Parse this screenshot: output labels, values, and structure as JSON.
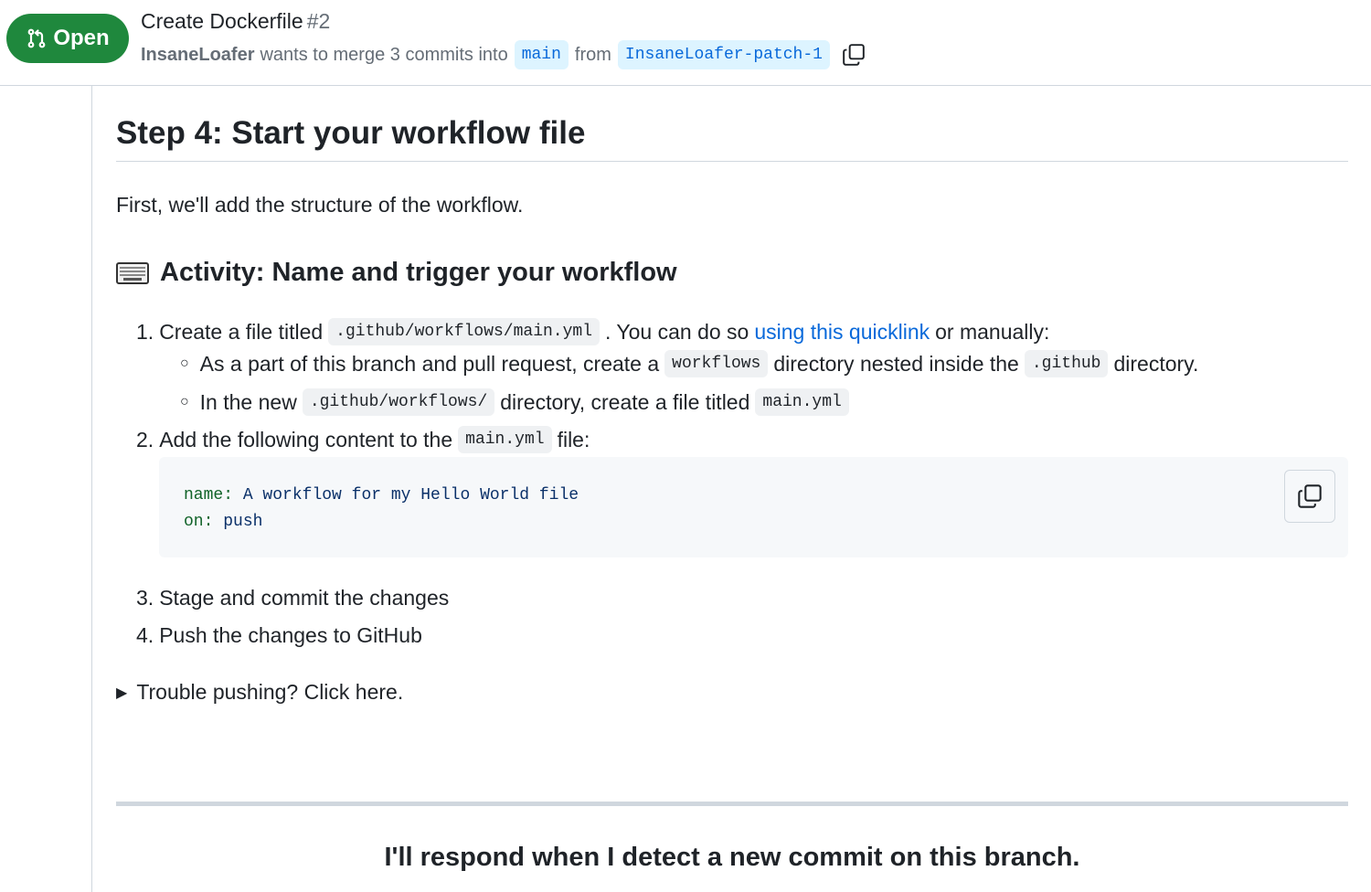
{
  "header": {
    "state_label": "Open",
    "title": "Create Dockerfile",
    "number": "#2",
    "author": "InsaneLoafer",
    "merge_text": "wants to merge 3 commits into",
    "base_branch": "main",
    "from_text": "from",
    "head_branch": "InsaneLoafer-patch-1",
    "copy_icon": "copy-icon",
    "state_color": "#1f883d"
  },
  "body": {
    "step_heading": "Step 4: Start your workflow file",
    "intro": "First, we'll add the structure of the workflow.",
    "activity_heading": "Activity: Name and trigger your workflow",
    "activity_icon": "keyboard-icon",
    "item1": {
      "num": "1.",
      "pre": "Create a file titled",
      "code": ".github/workflows/main.yml",
      "mid": ". You can do so",
      "link": "using this quicklink",
      "post": "or manually:"
    },
    "sub1": {
      "pre": "As a part of this branch and pull request, create a",
      "code1": "workflows",
      "mid": "directory nested inside the",
      "code2": ".github",
      "post": "directory."
    },
    "sub2": {
      "pre": "In the new",
      "code1": ".github/workflows/",
      "mid": "directory, create a file titled",
      "code2": "main.yml"
    },
    "item2": {
      "num": "2.",
      "pre": "Add the following content to the",
      "code": "main.yml",
      "post": "file:"
    },
    "code_block": {
      "line1_key": "name:",
      "line1_val": "A workflow for my Hello World file",
      "line2_key": "on:",
      "line2_val": "push"
    },
    "item3": {
      "num": "3.",
      "text": "Stage and commit the changes"
    },
    "item4": {
      "num": "4.",
      "text": "Push the changes to GitHub"
    },
    "details_summary": "Trouble pushing? Click here.",
    "respond_text": "I'll respond when I detect a new commit on this branch."
  }
}
